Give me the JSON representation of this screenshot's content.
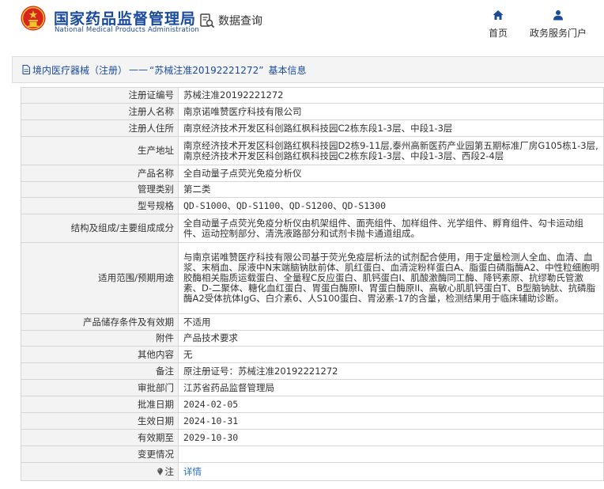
{
  "header": {
    "logo_title": "国家药品监督管理局",
    "logo_subtitle": "National Medical Products Administration",
    "query_label": "数据查询",
    "nav": {
      "home_label": "首页",
      "gov_label": "政务服务门户"
    }
  },
  "page_title": {
    "category": "境内医疗器械（注册）",
    "separator": "——",
    "record": "“苏械注准20192221272”",
    "suffix": "基本信息"
  },
  "rows": [
    {
      "label": "注册证编号",
      "value": "苏械注准20192221272"
    },
    {
      "label": "注册人名称",
      "value": "南京诺唯赞医疗科技有限公司"
    },
    {
      "label": "注册人住所",
      "value": "南京经济技术开发区科创路红枫科技园C2栋东段1-3层、中段1-3层"
    },
    {
      "label": "生产地址",
      "value": "南京经济技术开发区科创路红枫科技园D2栋9-11层,泰州高新医药产业园第五期标准厂房G105栋1-3层,南京经济技术开发区科创路红枫科技园C2栋东段1-3层、中段1-3层、西段2-4层"
    },
    {
      "label": "产品名称",
      "value": "全自动量子点荧光免疫分析仪"
    },
    {
      "label": "管理类别",
      "value": "第二类"
    },
    {
      "label": "型号规格",
      "value": "QD-S1000、QD-S1100、QD-S1200、QD-S1300"
    },
    {
      "label": "结构及组成/主要组成成分",
      "value": "全自动量子点荧光免疫分析仪由机架组件、面壳组件、加样组件、光学组件、孵育组件、勾卡运动组件、运动控制部分、清洗液路部分和试剂卡抛卡通道组成。"
    },
    {
      "label": "适用范围/预期用途",
      "value": "与南京诺唯赞医疗科技有限公司基于荧光免疫层析法的试剂配合使用，用于定量检测人全血、血清、血浆、末梢血、尿液中N末端脑钠肽前体、肌红蛋白、血清淀粉样蛋白A、脂蛋白磷脂酶A2、中性粒细胞明胶酶相关脂质运载蛋白、全量程C反应蛋白、肌钙蛋白I、肌酸激酶同工酶、降钙素原、抗缪勒氏管激素、D-二聚体、糖化血红蛋白、胃蛋白酶原I、胃蛋白酶原II、高敏心肌肌钙蛋白T、B型脑钠肽、抗磷脂酶A2受体抗体IgG、白介素6、人S100蛋白、胃泌素-17的含量，检测结果用于临床辅助诊断。"
    },
    {
      "label": "产品储存条件及有效期",
      "value": "不适用"
    },
    {
      "label": "附件",
      "value": "产品技术要求"
    },
    {
      "label": "其他内容",
      "value": "无"
    },
    {
      "label": "备注",
      "value": "原注册证号：苏械注准20192221272"
    },
    {
      "label": "审批部门",
      "value": "江苏省药品监督管理局"
    },
    {
      "label": "批准日期",
      "value": "2024-02-05"
    },
    {
      "label": "生效日期",
      "value": "2024-10-31"
    },
    {
      "label": "有效期至",
      "value": "2029-10-30"
    },
    {
      "label": "变更情况",
      "value": ""
    }
  ],
  "note_row": {
    "label": "注",
    "link_text": "详情"
  },
  "colors": {
    "brand_blue": "#1a4a9c",
    "link_blue": "#2a6fc4",
    "emblem_red": "#d8261e",
    "emblem_gold": "#f2c230"
  }
}
